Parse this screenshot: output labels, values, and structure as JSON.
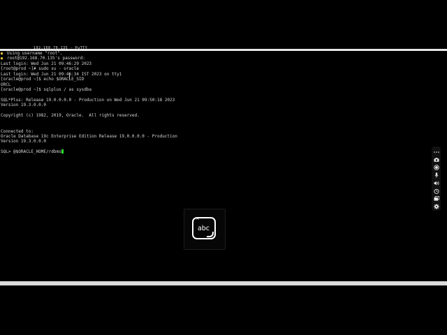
{
  "window": {
    "title": "192.168.70.135 - PuTTY"
  },
  "terminal": {
    "lines": [
      "Using username \"root\".",
      "root@192.168.70.135's password:",
      "Last login: Wed Jun 21 09:46:29 2023",
      "[root@prod ~]# sudo su - oracle",
      "Last login: Wed Jun 21 09:46:34 IST 2023 on tty1",
      "[oracle@prod ~]$ echo $ORACLE_SID",
      "ORCL",
      "[oracle@prod ~]$ sqlplus / as sysdba",
      "",
      "SQL*Plus: Release 19.0.0.0.0 - Production on Wed Jun 21 09:50:18 2023",
      "Version 19.3.0.0.0",
      "",
      "Copyright (c) 1982, 2019, Oracle.  All rights reserved.",
      "",
      "",
      "Connected to:",
      "Oracle Database 19c Enterprise Edition Release 19.0.0.0.0 - Production",
      "Version 19.3.0.0.0",
      "",
      "SQL> @$ORACLE_HOME/rdbms"
    ],
    "cursor_color": "#28e028"
  },
  "keyboard_overlay": {
    "label": "abc",
    "caret": "^"
  },
  "side_toolbar": {
    "buttons": [
      "more-icon",
      "camera-icon",
      "record-icon",
      "microphone-icon",
      "volume-icon",
      "timer-icon",
      "window-icon",
      "settings-icon"
    ]
  }
}
